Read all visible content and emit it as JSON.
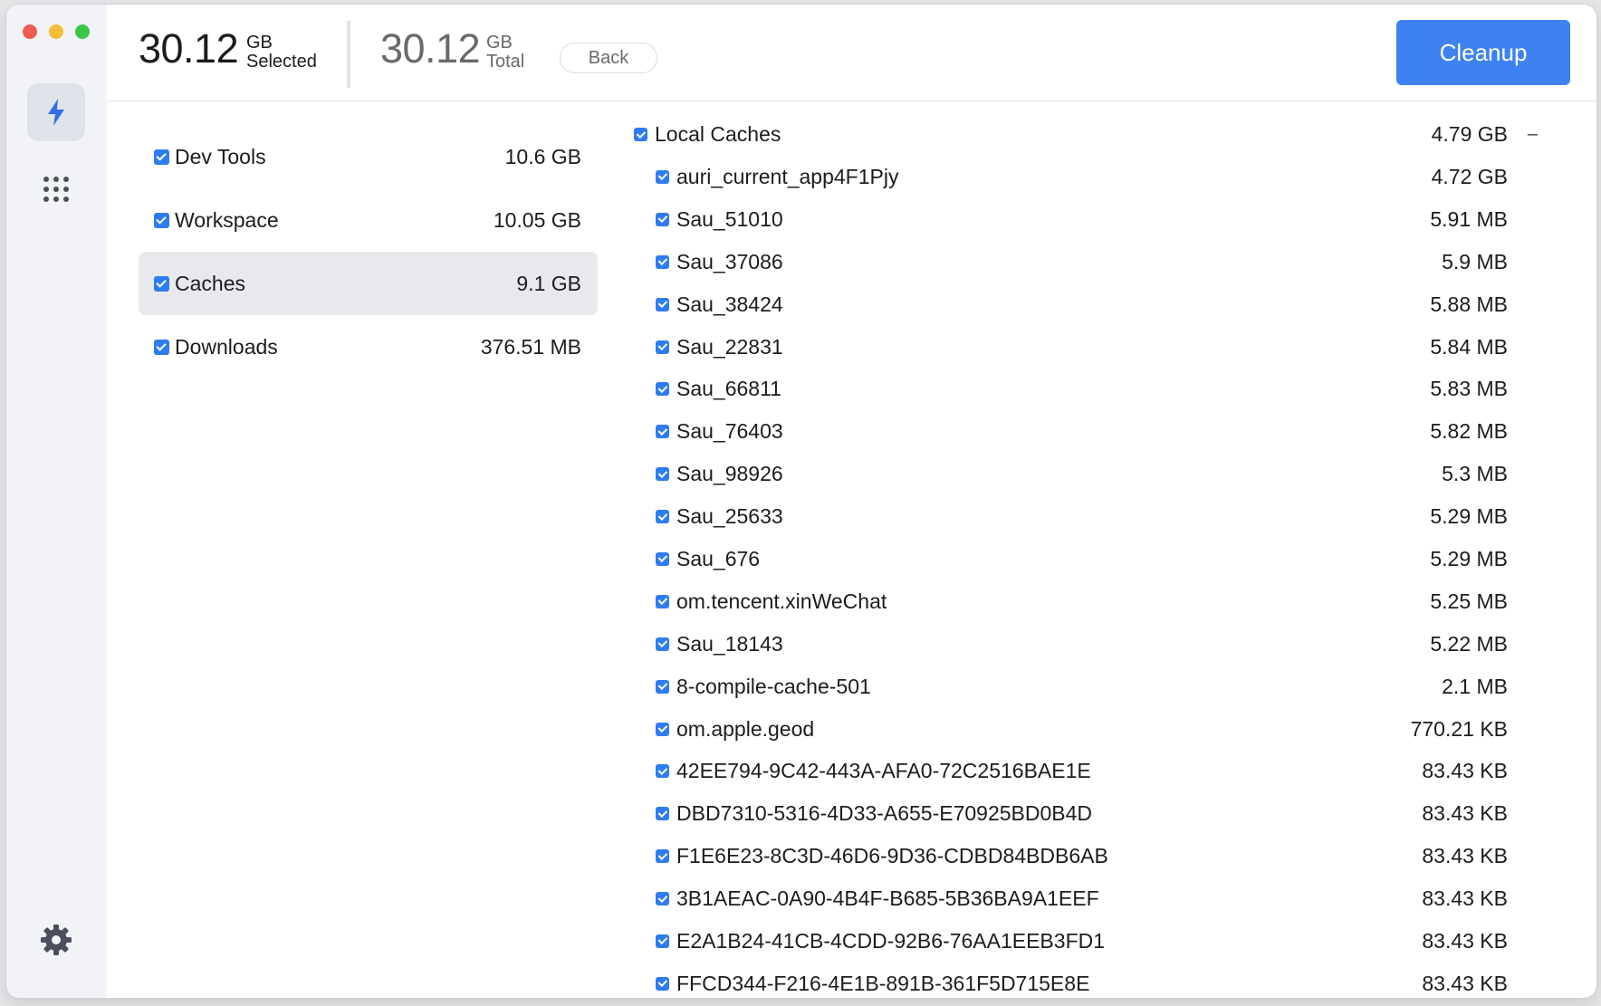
{
  "header": {
    "selected_value": "30.12",
    "selected_unit": "GB",
    "selected_label": "Selected",
    "total_value": "30.12",
    "total_unit": "GB",
    "total_label": "Total",
    "back_label": "Back",
    "cleanup_label": "Cleanup"
  },
  "sidebar": {
    "items": [
      {
        "name": "boost",
        "icon": "lightning-icon",
        "active": true
      },
      {
        "name": "apps",
        "icon": "grid-dots-icon",
        "active": false
      },
      {
        "name": "settings",
        "icon": "gear-icon",
        "active": false
      }
    ]
  },
  "categories": [
    {
      "name": "Dev Tools",
      "size": "10.6 GB",
      "checked": true,
      "selected": false
    },
    {
      "name": "Workspace",
      "size": "10.05 GB",
      "checked": true,
      "selected": false
    },
    {
      "name": "Caches",
      "size": "9.1 GB",
      "checked": true,
      "selected": true
    },
    {
      "name": "Downloads",
      "size": "376.51 MB",
      "checked": true,
      "selected": false
    }
  ],
  "group": {
    "name": "Local Caches",
    "size": "4.79 GB",
    "toggle": "–",
    "checked": true
  },
  "files": [
    {
      "name": "auri_current_app4F1Pjy",
      "size": "4.72 GB"
    },
    {
      "name": "Sau_51010",
      "size": "5.91 MB"
    },
    {
      "name": "Sau_37086",
      "size": "5.9 MB"
    },
    {
      "name": "Sau_38424",
      "size": "5.88 MB"
    },
    {
      "name": "Sau_22831",
      "size": "5.84 MB"
    },
    {
      "name": "Sau_66811",
      "size": "5.83 MB"
    },
    {
      "name": "Sau_76403",
      "size": "5.82 MB"
    },
    {
      "name": "Sau_98926",
      "size": "5.3 MB"
    },
    {
      "name": "Sau_25633",
      "size": "5.29 MB"
    },
    {
      "name": "Sau_676",
      "size": "5.29 MB"
    },
    {
      "name": "om.tencent.xinWeChat",
      "size": "5.25 MB"
    },
    {
      "name": "Sau_18143",
      "size": "5.22 MB"
    },
    {
      "name": "8-compile-cache-501",
      "size": "2.1 MB"
    },
    {
      "name": "om.apple.geod",
      "size": "770.21 KB"
    },
    {
      "name": "42EE794-9C42-443A-AFA0-72C2516BAE1E",
      "size": "83.43 KB"
    },
    {
      "name": "DBD7310-5316-4D33-A655-E70925BD0B4D",
      "size": "83.43 KB"
    },
    {
      "name": "F1E6E23-8C3D-46D6-9D36-CDBD84BDB6AB",
      "size": "83.43 KB"
    },
    {
      "name": "3B1AEAC-0A90-4B4F-B685-5B36BA9A1EEF",
      "size": "83.43 KB"
    },
    {
      "name": "E2A1B24-41CB-4CDD-92B6-76AA1EEB3FD1",
      "size": "83.43 KB"
    },
    {
      "name": "FFCD344-F216-4E1B-891B-361F5D715E8E",
      "size": "83.43 KB"
    }
  ],
  "colors": {
    "accent": "#3d82f0",
    "checkbox": "#2f7cf0",
    "sidebar_bg": "#f2f3f7",
    "selected_row_bg": "#e8e9ec"
  }
}
